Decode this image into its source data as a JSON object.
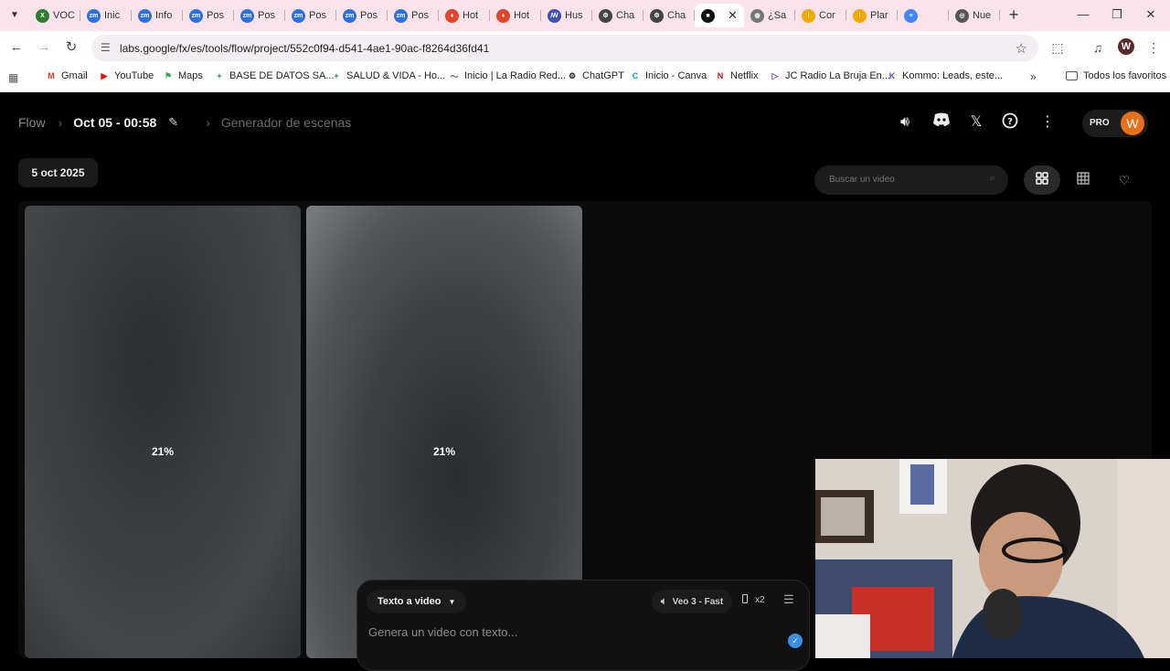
{
  "browser": {
    "tabs": [
      {
        "label": "VOC",
        "color": "#2e7d32",
        "glyph": "X"
      },
      {
        "label": "Inic",
        "color": "#2d6fe6",
        "glyph": "zm"
      },
      {
        "label": "Info",
        "color": "#2d6fe6",
        "glyph": "zm"
      },
      {
        "label": "Pos",
        "color": "#2d6fe6",
        "glyph": "zm"
      },
      {
        "label": "Pos",
        "color": "#2d6fe6",
        "glyph": "zm"
      },
      {
        "label": "Pos",
        "color": "#2d6fe6",
        "glyph": "zm"
      },
      {
        "label": "Pos",
        "color": "#2d6fe6",
        "glyph": "zm"
      },
      {
        "label": "Pos",
        "color": "#2d6fe6",
        "glyph": "zm"
      },
      {
        "label": "Hot",
        "color": "#e0452a",
        "glyph": "♦"
      },
      {
        "label": "Hot",
        "color": "#e0452a",
        "glyph": "♦"
      },
      {
        "label": "Hus",
        "color": "#3f51b5",
        "glyph": "ꟿ"
      },
      {
        "label": "Cha",
        "color": "#444444",
        "glyph": "⚙"
      },
      {
        "label": "Cha",
        "color": "#444444",
        "glyph": "⚙"
      },
      {
        "label": "",
        "color": "#111111",
        "glyph": "■",
        "active": true
      },
      {
        "label": "¿Sa",
        "color": "#777777",
        "glyph": "◍"
      },
      {
        "label": "Cor",
        "color": "#f2a900",
        "glyph": "!"
      },
      {
        "label": "Plar",
        "color": "#f2a900",
        "glyph": "!"
      },
      {
        "label": "",
        "color": "#4285f4",
        "glyph": "≡"
      },
      {
        "label": "Nue",
        "color": "#555555",
        "glyph": "◎"
      }
    ],
    "url": "labs.google/fx/es/tools/flow/project/552c0f94-d541-4ae1-90ac-f8264d36fd41",
    "profile_initial": "W",
    "bookmarks": [
      {
        "label": "Gmail",
        "color": "#d93025",
        "glyph": "M"
      },
      {
        "label": "YouTube",
        "color": "#ff0000",
        "glyph": "▶"
      },
      {
        "label": "Maps",
        "color": "#34a853",
        "glyph": "⚑"
      },
      {
        "label": "BASE DE DATOS SA...",
        "color": "#188038",
        "glyph": "+"
      },
      {
        "label": "SALUD & VIDA - Ho...",
        "color": "#188038",
        "glyph": "+"
      },
      {
        "label": "Inicio | La Radio Red...",
        "color": "#555555",
        "glyph": "～"
      },
      {
        "label": "ChatGPT",
        "color": "#222222",
        "glyph": "⚙"
      },
      {
        "label": "Inicio - Canva",
        "color": "#00a3c4",
        "glyph": "C"
      },
      {
        "label": "Netflix",
        "color": "#e50914",
        "glyph": "N"
      },
      {
        "label": "JC Radio La Bruja En...",
        "color": "#7b3fe4",
        "glyph": "▷"
      },
      {
        "label": "Kommo: Leads, este...",
        "color": "#5a3fd6",
        "glyph": "K"
      }
    ],
    "bookmarks_folder": "Todos los favoritos"
  },
  "app": {
    "breadcrumb": {
      "root": "Flow",
      "project": "Oct 05 - 00:58",
      "section": "Generador de escenas"
    },
    "pro_label": "PRO",
    "avatar_initial": "W",
    "date_chip": "5 oct 2025",
    "search_placeholder": "Buscar un video",
    "cards": [
      {
        "progress_label": "21%"
      },
      {
        "progress_label": "21%"
      }
    ],
    "composer": {
      "mode": "Texto a video",
      "model": "Veo 3 - Fast",
      "count": "x2",
      "placeholder": "Genera un video con texto..."
    }
  }
}
